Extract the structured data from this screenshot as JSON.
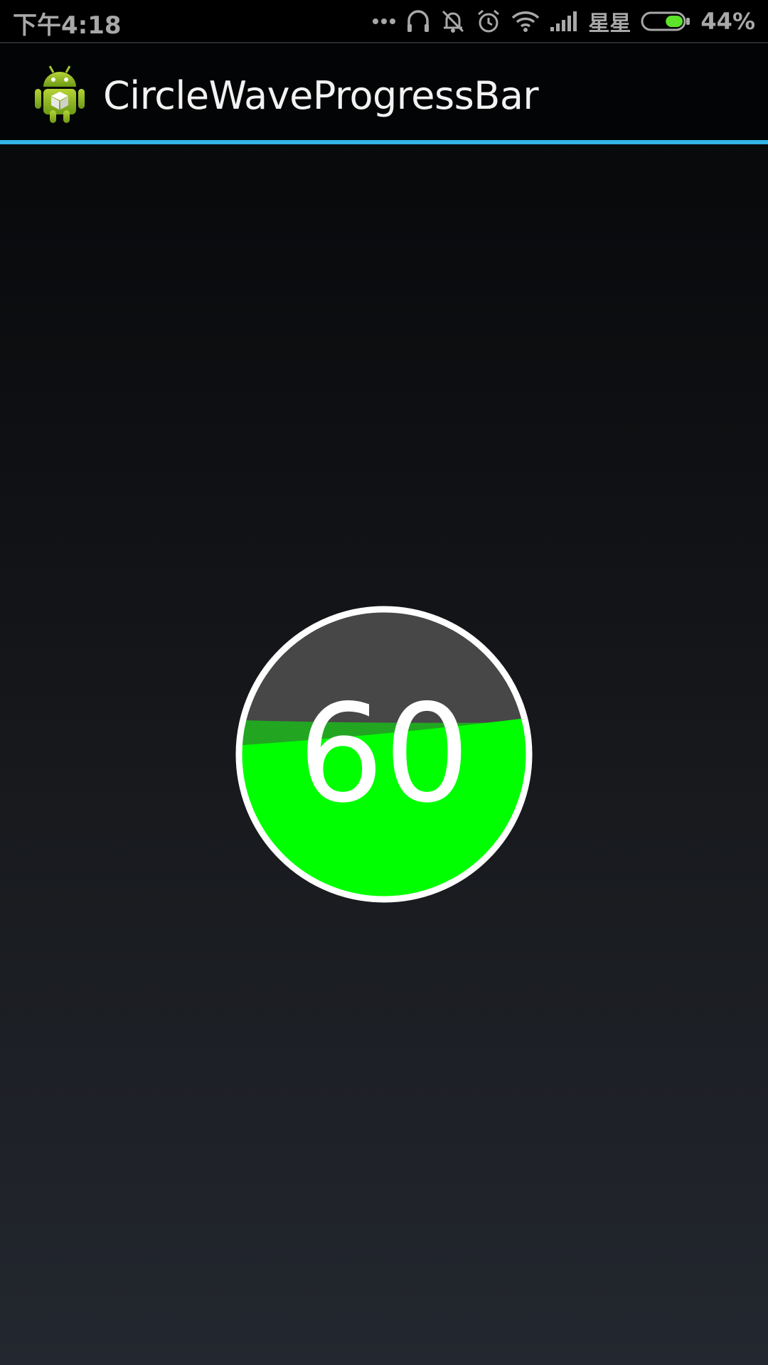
{
  "status_bar": {
    "time": "下午4:18",
    "carrier": "星星",
    "battery_percent": "44%",
    "battery_level": 0.44,
    "icons": [
      "more-dots-icon",
      "headset-icon",
      "silent-vibrate-icon",
      "alarm-icon",
      "wifi-icon",
      "signal-icon",
      "battery-icon"
    ]
  },
  "action_bar": {
    "app_icon": "android-robot-icon",
    "title": "CircleWaveProgressBar",
    "divider_color": "#33b5e5"
  },
  "wave_progress": {
    "value": "60",
    "progress_fraction": 0.6,
    "fill_color": "#00ff00",
    "back_wave_color": "#22a622",
    "empty_color": "#474747",
    "border_color": "#ffffff"
  }
}
